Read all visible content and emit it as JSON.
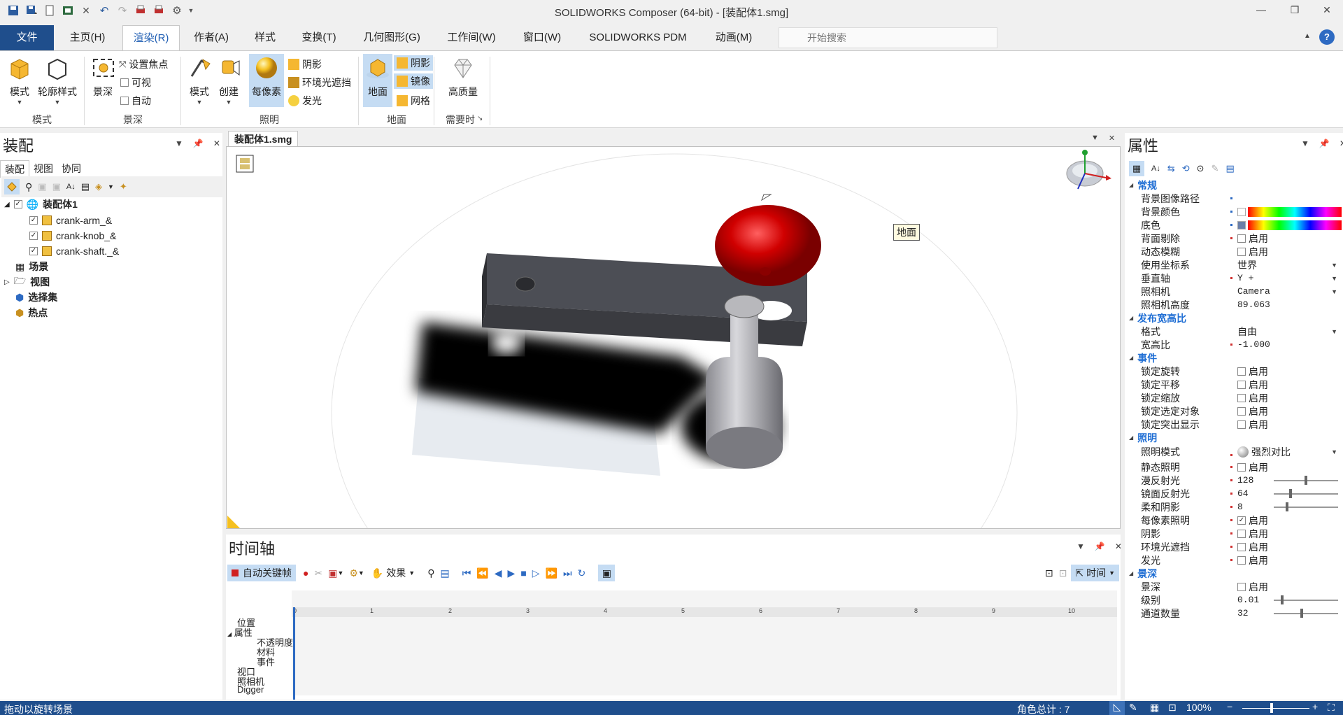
{
  "app_title": "SOLIDWORKS Composer (64-bit) - [装配体1.smg]",
  "menu_tabs": [
    "文件",
    "主页(H)",
    "渲染(R)",
    "作者(A)",
    "样式",
    "变换(T)",
    "几何图形(G)",
    "工作间(W)",
    "窗口(W)",
    "SOLIDWORKS PDM",
    "动画(M)"
  ],
  "search_placeholder": "开始搜索",
  "ribbon": {
    "group_mode": {
      "label": "模式",
      "btn_mode": "模式",
      "btn_outline": "轮廓样式"
    },
    "group_dof": {
      "label": "景深",
      "btn_dof": "景深",
      "set_focus": "设置焦点",
      "visible": "可视",
      "auto": "自动"
    },
    "group_light": {
      "label": "照明",
      "btn_mode": "模式",
      "btn_create": "创建",
      "btn_perpixel": "每像素",
      "shadow": "阴影",
      "ambient": "环境光遮挡",
      "glow": "发光"
    },
    "group_ground": {
      "label": "地面",
      "btn_ground": "地面",
      "shadow": "阴影",
      "mirror": "镜像",
      "grid": "网格"
    },
    "group_quality": {
      "label": "需要时",
      "btn_hq": "高质量"
    }
  },
  "left_panel": {
    "title": "装配",
    "tabs": [
      "装配",
      "视图",
      "协同"
    ],
    "tree": {
      "root": "装配体1",
      "parts": [
        "crank-arm_&",
        "crank-knob_&",
        "crank-shaft._&"
      ],
      "scene": "场景",
      "views": "视图",
      "selection_sets": "选择集",
      "hotspots": "热点"
    }
  },
  "doc_tab": "装配体1.smg",
  "viewport": {
    "callout": "地面"
  },
  "timeline": {
    "title": "时间轴",
    "auto_key": "自动关键帧",
    "effects": "效果",
    "time_mode": "时间",
    "ruler_ticks": [
      "0",
      "1",
      "2",
      "3",
      "4",
      "5",
      "6",
      "7",
      "8",
      "9",
      "10"
    ],
    "tracks": [
      "位置",
      "属性",
      "不透明度",
      "材料",
      "事件",
      "视口",
      "照相机",
      "Digger"
    ]
  },
  "properties": {
    "title": "属性",
    "categories": {
      "general": "常规",
      "aspect": "发布宽高比",
      "events": "事件",
      "lighting": "照明",
      "dof": "景深"
    },
    "enable_label": "启用",
    "general": [
      {
        "name": "背景图像路径",
        "value": ""
      },
      {
        "name": "背景颜色",
        "value": ""
      },
      {
        "name": "底色",
        "value": ""
      },
      {
        "name": "背面剔除",
        "value": "启用"
      },
      {
        "name": "动态模糊",
        "value": "启用"
      },
      {
        "name": "使用坐标系",
        "value": "世界"
      },
      {
        "name": "垂直轴",
        "value": "Y +"
      },
      {
        "name": "照相机",
        "value": "Camera"
      },
      {
        "name": "照相机高度",
        "value": "89.063"
      }
    ],
    "aspect": [
      {
        "name": "格式",
        "value": "自由"
      },
      {
        "name": "宽高比",
        "value": "-1.000"
      }
    ],
    "events": [
      "锁定旋转",
      "锁定平移",
      "锁定缩放",
      "锁定选定对象",
      "锁定突出显示"
    ],
    "lighting": [
      {
        "name": "照明模式",
        "value": "强烈对比"
      },
      {
        "name": "静态照明",
        "value": "启用"
      },
      {
        "name": "漫反射光",
        "value": "128"
      },
      {
        "name": "镜面反射光",
        "value": "64"
      },
      {
        "name": "柔和阴影",
        "value": "8"
      },
      {
        "name": "每像素照明",
        "value": "启用"
      },
      {
        "name": "阴影",
        "value": "启用"
      },
      {
        "name": "环境光遮挡",
        "value": "启用"
      },
      {
        "name": "发光",
        "value": "启用"
      }
    ],
    "dof": [
      {
        "name": "景深",
        "value": "启用"
      },
      {
        "name": "级别",
        "value": "0.01"
      },
      {
        "name": "通道数量",
        "value": "32"
      }
    ]
  },
  "status": {
    "hint": "拖动以旋转场景",
    "actor_count": "角色总计 : 7",
    "zoom": "100%"
  },
  "colors": {
    "file_tab": "#1f4e8c",
    "accent": "#1f6ed4",
    "knob": "#c00000",
    "status": "#1f4e8c"
  }
}
